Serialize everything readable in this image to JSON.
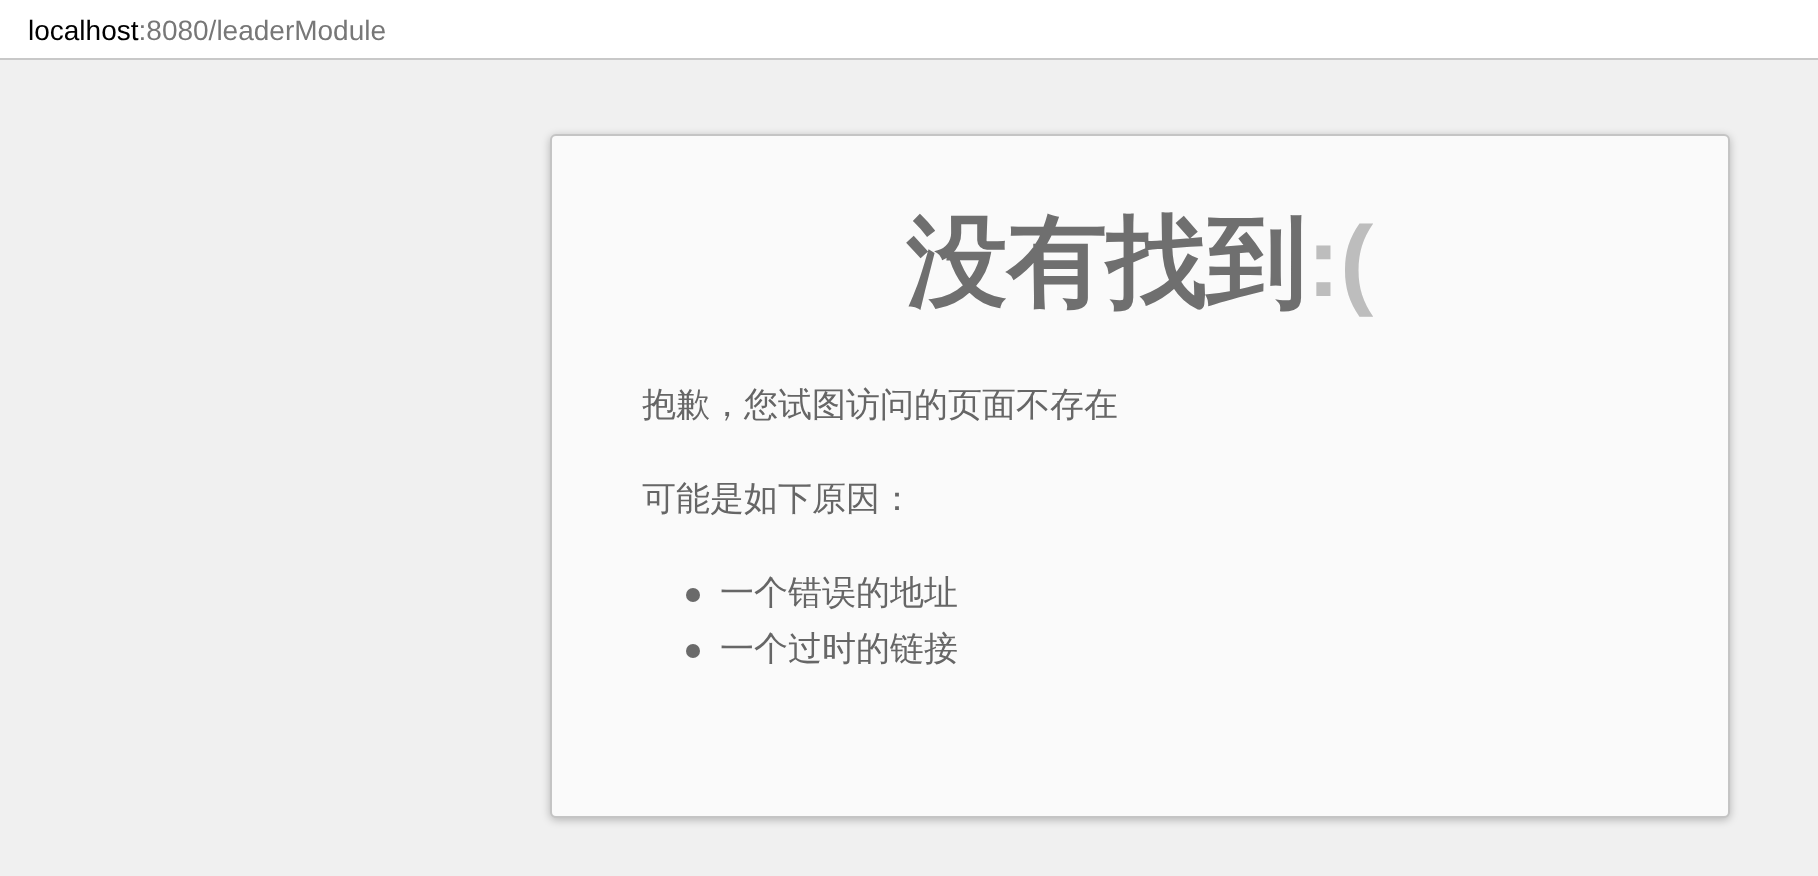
{
  "address_bar": {
    "host": "localhost",
    "path": ":8080/leaderModule"
  },
  "card": {
    "title": "没有找到",
    "emoticon": ":(",
    "message": "抱歉，您试图访问的页面不存在",
    "reasons_heading": "可能是如下原因：",
    "reasons": [
      "一个错误的地址",
      "一个过时的链接"
    ]
  }
}
